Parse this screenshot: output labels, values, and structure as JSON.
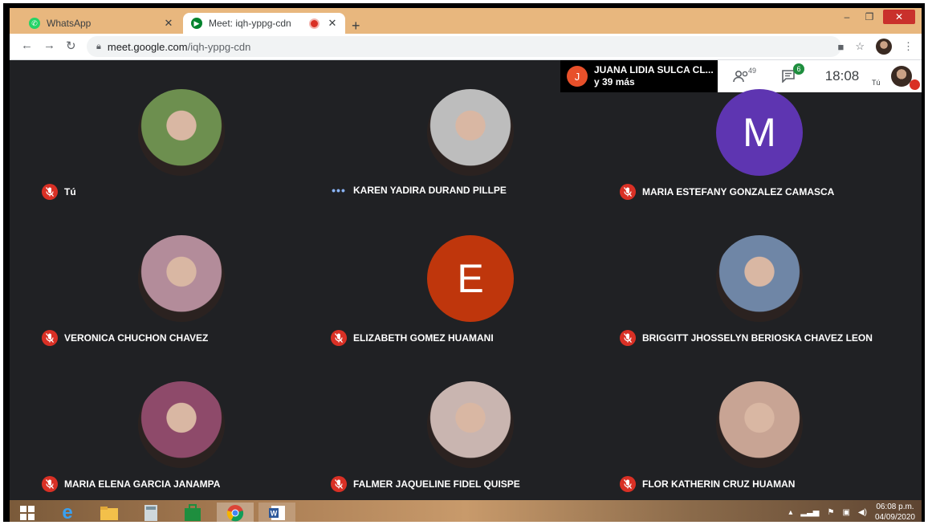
{
  "browser": {
    "tabs": [
      {
        "title": "WhatsApp",
        "icon": "whatsapp-icon",
        "active": false
      },
      {
        "title": "Meet: iqh-yppg-cdn",
        "icon": "meet-icon",
        "active": true
      }
    ],
    "url_host": "meet.google.com",
    "url_path": "/iqh-yppg-cdn"
  },
  "meet": {
    "presenter": {
      "initial": "J",
      "name": "JUANA LIDIA SULCA CL...",
      "more": "y 39 más"
    },
    "people_count": "49",
    "chat_badge": "6",
    "time": "18:08",
    "self_label": "Tú",
    "participants": [
      {
        "name": "Tú",
        "muted": true,
        "avatar": "photo",
        "color": "#6d8f4f"
      },
      {
        "name": "KAREN YADIRA DURAND PILLPE",
        "muted": false,
        "avatar": "photo",
        "color": "#bdbdbd"
      },
      {
        "name": "MARIA ESTEFANY GONZALEZ CAMASCA",
        "muted": true,
        "avatar": "letter",
        "letter": "M",
        "color": "#5e35b1"
      },
      {
        "name": "VERONICA CHUCHON CHAVEZ",
        "muted": true,
        "avatar": "photo",
        "color": "#b38c9a"
      },
      {
        "name": "ELIZABETH GOMEZ HUAMANI",
        "muted": true,
        "avatar": "letter",
        "letter": "E",
        "color": "#bf360c"
      },
      {
        "name": "BRIGGITT JHOSSELYN BERIOSKA CHAVEZ LEON",
        "muted": true,
        "avatar": "photo",
        "color": "#6f86a6"
      },
      {
        "name": "MARIA ELENA GARCIA JANAMPA",
        "muted": true,
        "avatar": "photo",
        "color": "#8e4a6a"
      },
      {
        "name": "FALMER JAQUELINE FIDEL QUISPE",
        "muted": true,
        "avatar": "photo",
        "color": "#c9b5b0"
      },
      {
        "name": "FLOR KATHERIN CRUZ HUAMAN",
        "muted": true,
        "avatar": "photo",
        "color": "#c8a494"
      }
    ]
  },
  "taskbar": {
    "clock_time": "06:08 p.m.",
    "clock_date": "04/09/2020"
  }
}
